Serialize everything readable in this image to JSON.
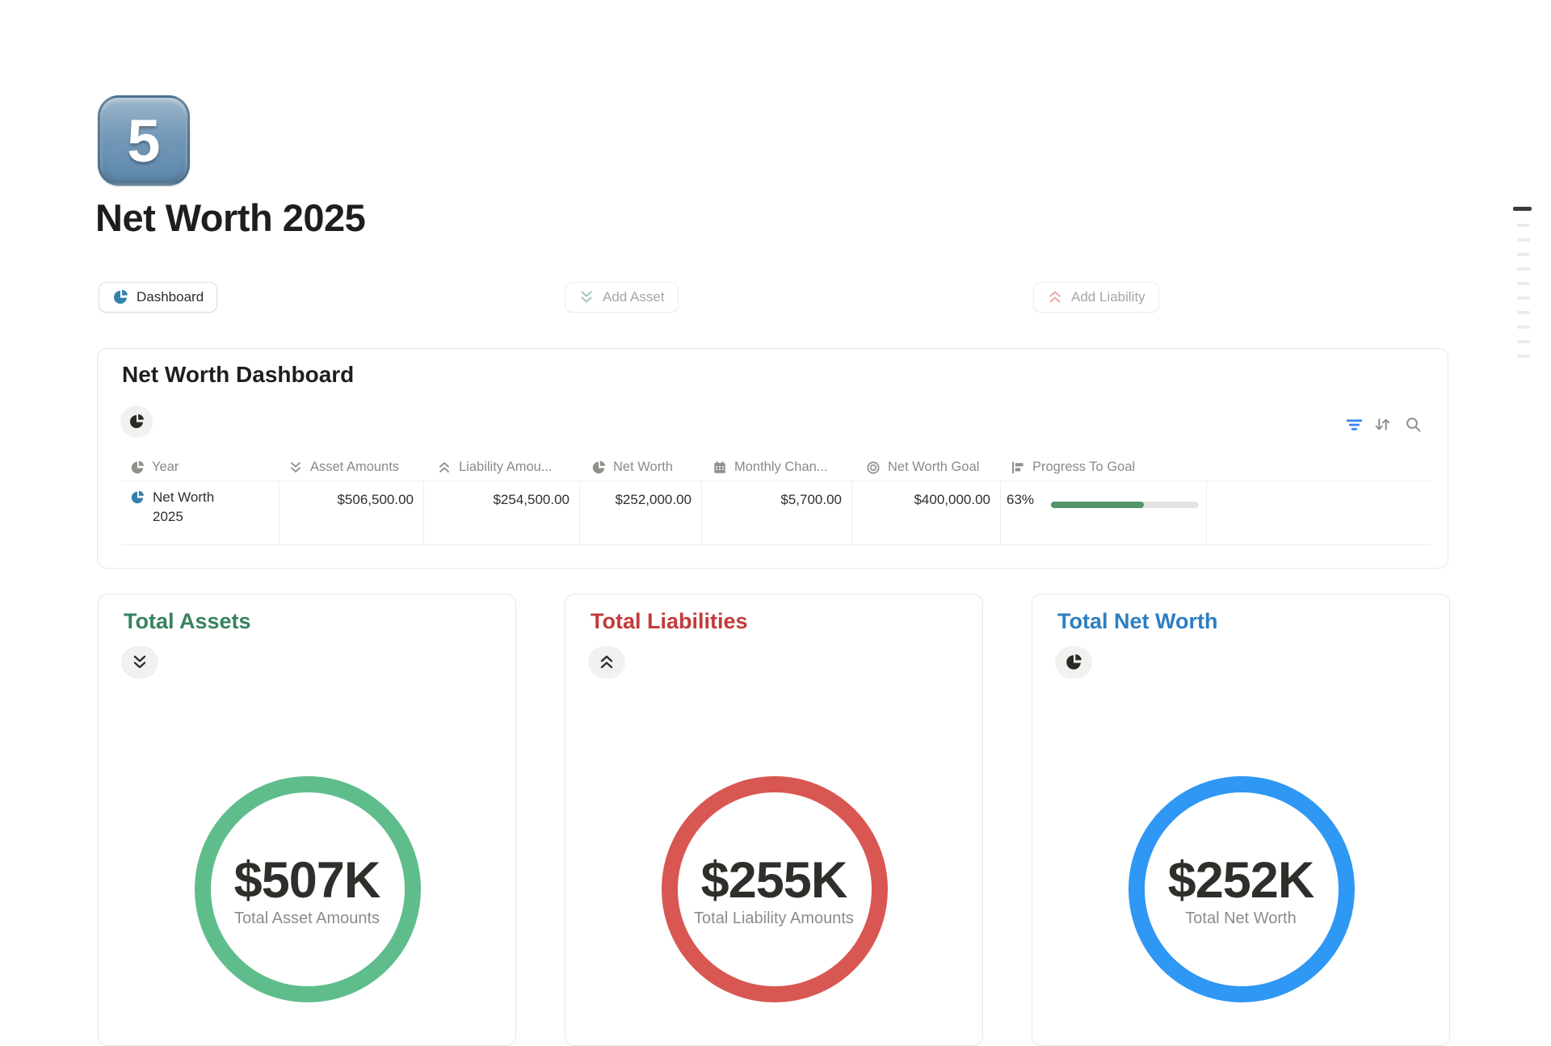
{
  "page": {
    "icon_digit": "5",
    "title": "Net Worth 2025"
  },
  "toolbar": {
    "dashboard_label": "Dashboard",
    "add_asset_label": "Add Asset",
    "add_liability_label": "Add Liability"
  },
  "dashboard_card": {
    "title": "Net Worth Dashboard",
    "table": {
      "columns": [
        {
          "icon": "pie-chart",
          "label": "Year"
        },
        {
          "icon": "double-chevron-down",
          "label": "Asset Amounts"
        },
        {
          "icon": "double-chevron-up",
          "label": "Liability Amou..."
        },
        {
          "icon": "pie-chart",
          "label": "Net Worth"
        },
        {
          "icon": "calendar",
          "label": "Monthly Chan..."
        },
        {
          "icon": "target",
          "label": "Net Worth Goal"
        },
        {
          "icon": "progress-flag",
          "label": "Progress To Goal"
        }
      ],
      "rows": [
        {
          "year": "Net Worth 2025",
          "asset_amounts": "$506,500.00",
          "liability_amounts": "$254,500.00",
          "net_worth": "$252,000.00",
          "monthly_change": "$5,700.00",
          "net_worth_goal": "$400,000.00",
          "progress_label": "63%",
          "progress_width": "63%"
        }
      ]
    }
  },
  "summary_cards": [
    {
      "title": "Total Assets",
      "value": "$507K",
      "label": "Total Asset Amounts",
      "ring_color": "#5FBD8C",
      "title_color": "#38835F",
      "pill_icon": "double-chevron-down"
    },
    {
      "title": "Total Liabilities",
      "value": "$255K",
      "label": "Total Liability Amounts",
      "ring_color": "#D95752",
      "title_color": "#C23B3B",
      "pill_icon": "double-chevron-up"
    },
    {
      "title": "Total Net Worth",
      "value": "$252K",
      "label": "Total Net Worth",
      "ring_color": "#2F97F4",
      "title_color": "#2E7EC2",
      "pill_icon": "pie-chart"
    }
  ],
  "icons": {
    "page-icon": "keycap-5",
    "dashboard-button-icon": "pie-chart",
    "add-asset-icon": "double-chevron-down",
    "add-liability-icon": "double-chevron-up",
    "view-pill-icon": "pie-chart",
    "filter-icon": "filter-lines",
    "sort-icon": "arrows-up-down",
    "search-icon": "magnifier"
  },
  "colors": {
    "assets_green": "#5FBD8C",
    "assets_title_green": "#38835F",
    "liabilities_red": "#D95752",
    "liabilities_title_red": "#C23B3B",
    "net_worth_blue": "#2F97F4",
    "net_worth_title_blue": "#2E7EC2",
    "progress_fill_green": "#53966A",
    "dashboard_pie_blue": "#3581AD",
    "filter_blue": "#3B82F6"
  }
}
